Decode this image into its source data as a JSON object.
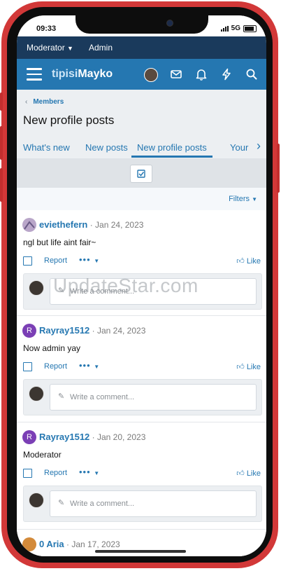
{
  "status": {
    "time": "09:33",
    "network": "5G"
  },
  "admin_bar": {
    "moderator": "Moderator",
    "admin": "Admin"
  },
  "logo": {
    "part1": "tipisi",
    "part2": "Mayko"
  },
  "breadcrumb": {
    "label": "Members"
  },
  "page": {
    "title": "New profile posts"
  },
  "tabs": [
    {
      "label": "What's new"
    },
    {
      "label": "New posts"
    },
    {
      "label": "New profile posts"
    },
    {
      "label": "Your"
    }
  ],
  "filters": {
    "label": "Filters"
  },
  "posts": [
    {
      "author": "eviethefern",
      "date": "Jan 24, 2023",
      "body": "ngl but life aint fair~",
      "avatar_color": "#b9a6c9",
      "avatar_letter": ""
    },
    {
      "author": "Rayray1512",
      "date": "Jan 24, 2023",
      "body": "Now admin yay",
      "avatar_color": "#7b3fb5",
      "avatar_letter": "R"
    },
    {
      "author": "Rayray1512",
      "date": "Jan 20, 2023",
      "body": "Moderator",
      "avatar_color": "#7b3fb5",
      "avatar_letter": "R"
    },
    {
      "author": "0 Aria",
      "date": "Jan 17, 2023",
      "body": "",
      "avatar_color": "#d38a3a",
      "avatar_letter": ""
    }
  ],
  "actions": {
    "report": "Report",
    "more": "•••",
    "like": "Like"
  },
  "comment": {
    "placeholder": "Write a comment..."
  },
  "watermark": "UpdateStar.com",
  "colors": {
    "accent": "#2577b1",
    "admin_bar": "#1a3a5c",
    "phone_frame": "#d23838"
  }
}
